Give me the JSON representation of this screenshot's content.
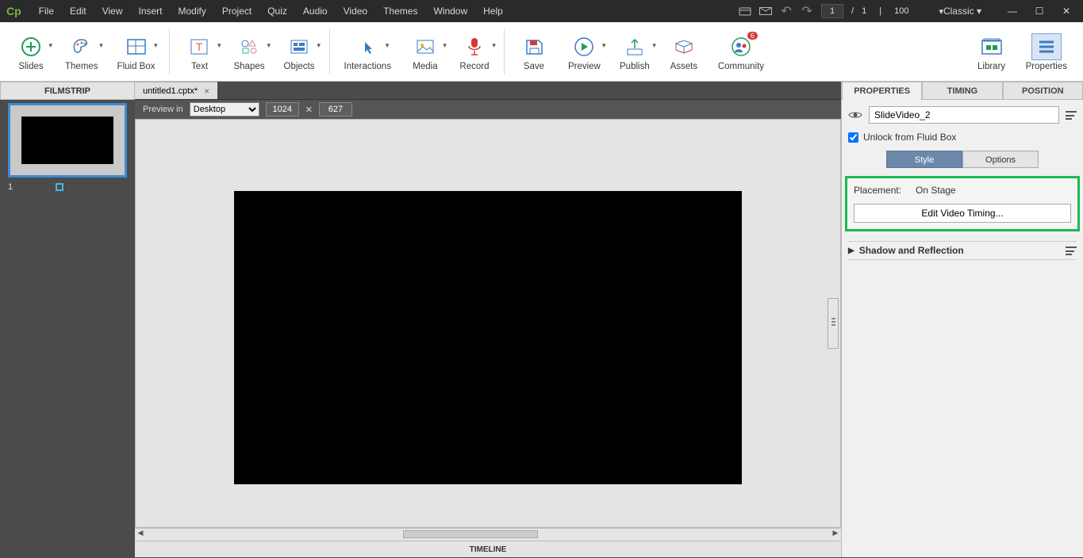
{
  "app": {
    "logo": "Cp",
    "workspace": "Classic"
  },
  "menu": [
    "File",
    "Edit",
    "View",
    "Insert",
    "Modify",
    "Project",
    "Quiz",
    "Audio",
    "Video",
    "Themes",
    "Window",
    "Help"
  ],
  "status": {
    "current_slide": "1",
    "total_slides": "1",
    "zoom": "100"
  },
  "toolbar": {
    "slides": "Slides",
    "themes": "Themes",
    "fluidbox": "Fluid Box",
    "text": "Text",
    "shapes": "Shapes",
    "objects": "Objects",
    "interactions": "Interactions",
    "media": "Media",
    "record": "Record",
    "save": "Save",
    "preview": "Preview",
    "publish": "Publish",
    "assets": "Assets",
    "community": "Community",
    "community_badge": "6",
    "library": "Library",
    "properties": "Properties"
  },
  "filmstrip": {
    "title": "FILMSTRIP",
    "slide_num": "1"
  },
  "tabs": {
    "file": "untitled1.cptx*"
  },
  "preview": {
    "label": "Preview in",
    "device": "Desktop",
    "w": "1024",
    "h": "627"
  },
  "timeline": "TIMELINE",
  "props": {
    "tab_properties": "PROPERTIES",
    "tab_timing": "TIMING",
    "tab_position": "POSITION",
    "name": "SlideVideo_2",
    "unlock_label": "Unlock from Fluid Box",
    "sub_style": "Style",
    "sub_options": "Options",
    "placement_label": "Placement:",
    "placement_value": "On Stage",
    "edit_btn": "Edit Video Timing...",
    "section_shadow": "Shadow and Reflection"
  }
}
